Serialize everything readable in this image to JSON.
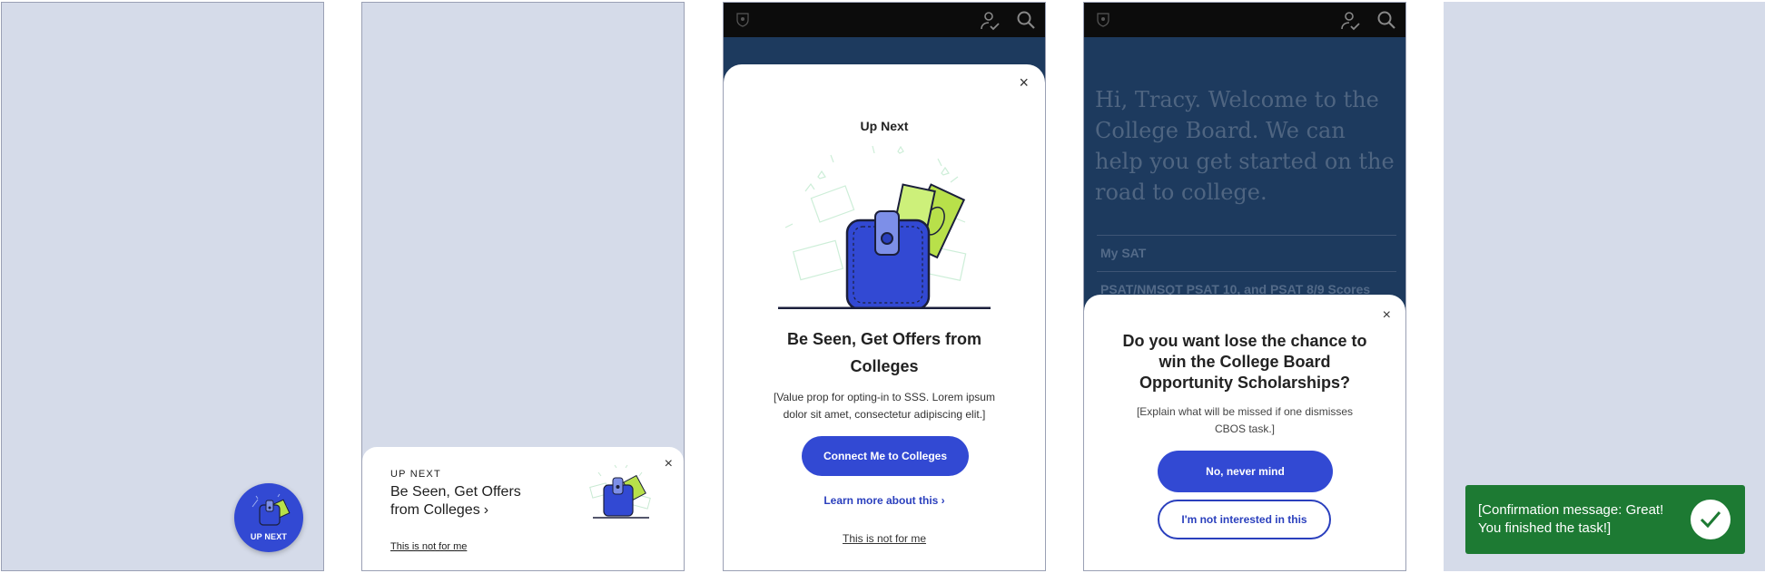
{
  "colors": {
    "brand_blue": "#3249d3",
    "link_blue": "#2a3fbd",
    "panel_bg": "#d5dbe9",
    "dark_bg": "#1d3a5e",
    "topbar_bg": "#0c0c0c",
    "success_green": "#1d7a33",
    "money_green": "#b8e04a"
  },
  "icons": {
    "logo": "acorn-shield-icon",
    "profile": "person-check-icon",
    "search": "search-icon",
    "close": "close-icon",
    "chevron": "chevron-right-icon",
    "wallet": "wallet-icon",
    "check": "check-icon"
  },
  "screen1": {
    "fab_label": "UP NEXT"
  },
  "screen2": {
    "eyebrow": "UP NEXT",
    "title": "Be Seen, Get Offers from Colleges",
    "chevron": "›",
    "dismiss": "This is not for me",
    "close": "×"
  },
  "screen3": {
    "close": "×",
    "eyebrow": "Up Next",
    "title": "Be Seen, Get Offers from Colleges",
    "description": "[Value prop for opting-in to SSS. Lorem ipsum dolor sit amet, consectetur adipiscing elit.]",
    "primary_button": "Connect Me to Colleges",
    "learn_more": "Learn more about this ›",
    "dismiss": "This is not for me"
  },
  "screen4": {
    "welcome": "Hi, Tracy. Welcome to the College Board. We can help you get started on the road to college.",
    "menu": [
      "My SAT",
      "PSAT/NMSQT PSAT 10, and PSAT 8/9 Scores"
    ],
    "close": "×",
    "title": "Do you want lose the chance to win the College Board Opportunity Scholarships?",
    "description": "[Explain what will be missed if one dismisses CBOS task.]",
    "primary_button": "No, never mind",
    "secondary_button": "I'm not interested in this"
  },
  "screen5": {
    "toast": "[Confirmation message: Great! You finished the task!]"
  }
}
